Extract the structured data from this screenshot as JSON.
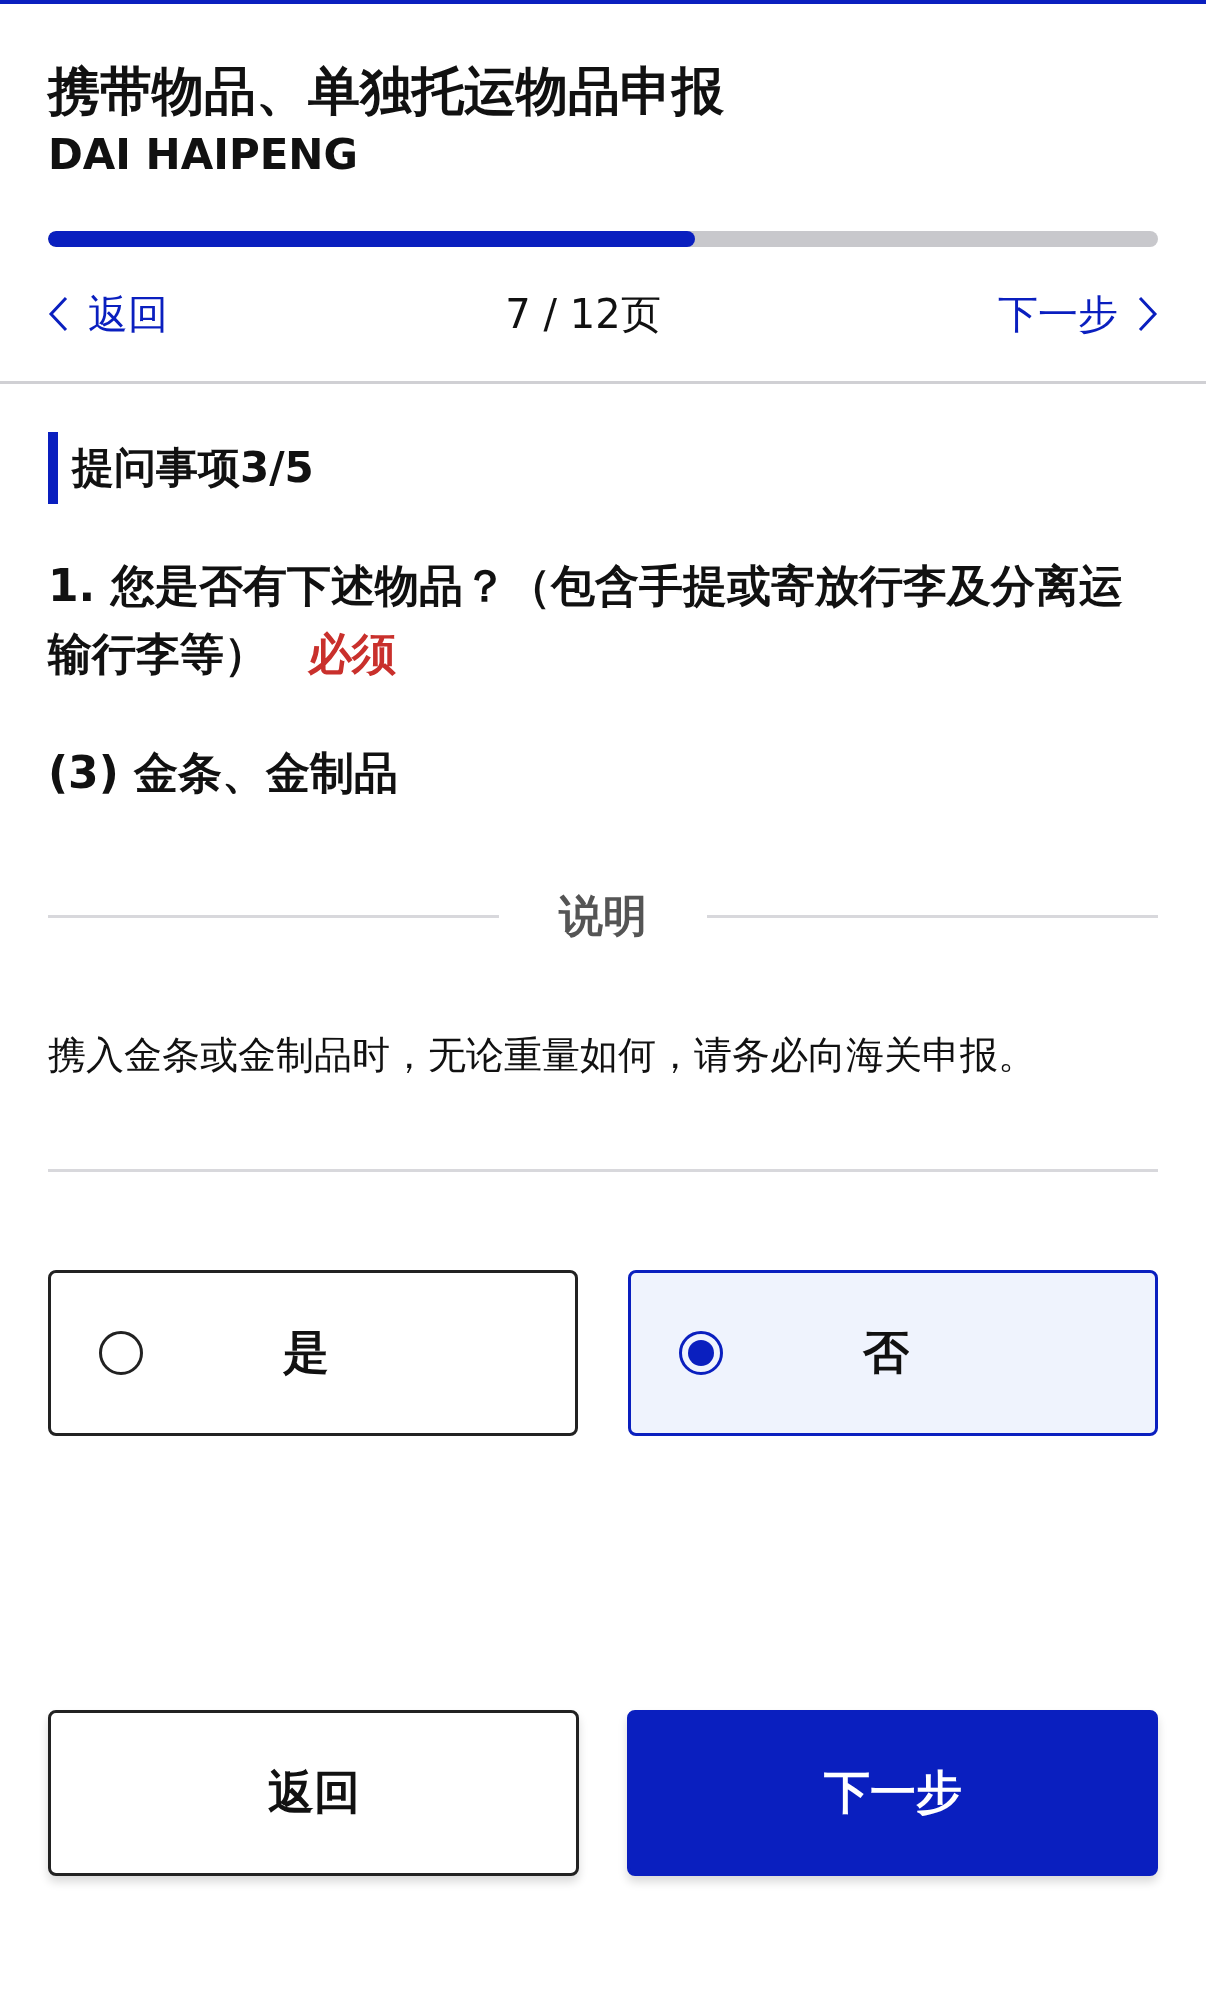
{
  "header": {
    "title": "携带物品、单独托运物品申报",
    "name": "DAI HAIPENG"
  },
  "progress": {
    "level": 0.583
  },
  "nav": {
    "back": "返回",
    "page": "7 / 12页",
    "next": "下一步"
  },
  "section": {
    "heading": "提问事项3/5"
  },
  "question": {
    "text": "1. 您是否有下述物品？（包含手提或寄放行李及分离运输行李等）",
    "required": "必须"
  },
  "item": "(3) 金条、金制品",
  "note": {
    "heading": "说明",
    "text": "携入金条或金制品时，无论重量如何，请务必向海关申报。"
  },
  "options": [
    {
      "label": "是",
      "selected": false
    },
    {
      "label": "否",
      "selected": true
    }
  ],
  "buttons": [
    {
      "label": "返回",
      "kind": "secondary"
    },
    {
      "label": "下一步",
      "kind": "primary"
    }
  ]
}
